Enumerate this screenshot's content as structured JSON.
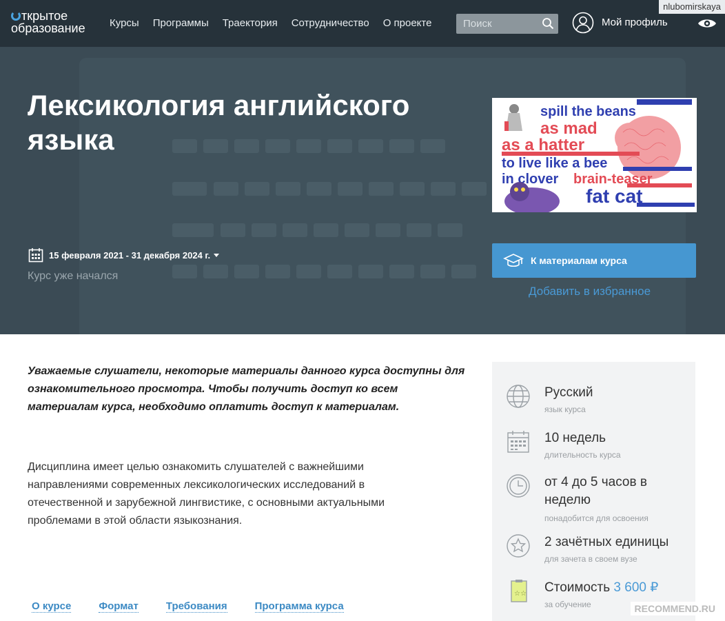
{
  "header": {
    "logo_line1": "ткрытое",
    "logo_line2": "образование",
    "nav": [
      "Курсы",
      "Программы",
      "Траектория",
      "Сотрудничество",
      "О проекте"
    ],
    "search_placeholder": "Поиск",
    "profile_label": "Мой профиль",
    "username": "nlubomirskaya"
  },
  "hero": {
    "title": "Лексикология английского языка",
    "dates": "15 февраля 2021 - 31 декабря 2024 г.",
    "status": "Курс уже начался",
    "materials_button": "К материалам курса",
    "favorite_link": "Добавить в избранное",
    "image_phrases": [
      "spill the beans",
      "as mad",
      "as a hatter",
      "to live like a bee",
      "in clover",
      "brain-teaser",
      "fat cat"
    ]
  },
  "main": {
    "notice": "Уважаемые слушатели, некоторые материалы данного курса доступны для ознакомительного просмотра. Чтобы получить доступ ко всем материалам курса, необходимо оплатить доступ к материалам.",
    "description": "Дисциплина имеет целью ознакомить слушателей с важнейшими направлениями современных лексикологических исследований в отечественной и зарубежной лингвистике, с основными актуальными проблемами в этой области языкознания.",
    "tabs": [
      "О курсе",
      "Формат",
      "Требования",
      "Программа курса"
    ]
  },
  "sidebar": {
    "language": {
      "value": "Русский",
      "sub": "язык курса"
    },
    "duration": {
      "value": "10 недель",
      "sub": "длительность курса"
    },
    "effort": {
      "value": "от 4 до 5 часов в неделю",
      "sub": "понадобится для освоения"
    },
    "credits": {
      "value": "2 зачётных единицы",
      "sub": "для зачета в своем вузе"
    },
    "cost": {
      "label": "Стоимость",
      "price": "3 600 ₽",
      "sub": "за обучение"
    }
  },
  "watermark": "RECOMMEND.RU",
  "colors": {
    "accent": "#4697d1",
    "header": "#26323a",
    "hero": "#3b4b55",
    "link": "#4a9ad6"
  }
}
